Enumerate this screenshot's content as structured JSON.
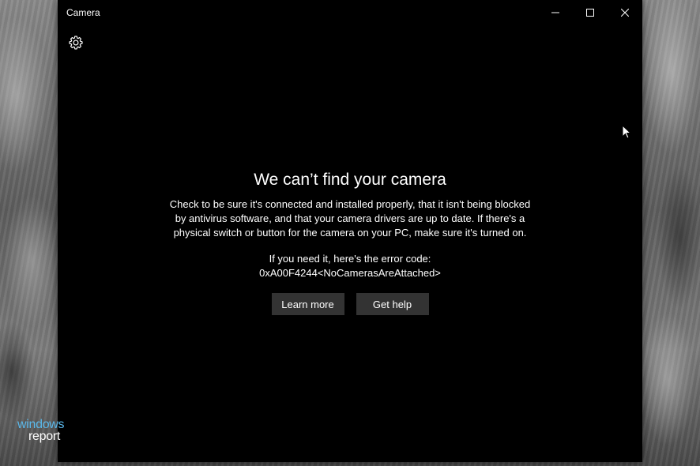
{
  "window": {
    "title": "Camera"
  },
  "controls": {
    "minimize": "minimize-icon",
    "maximize": "maximize-icon",
    "close": "close-icon",
    "settings": "gear-icon"
  },
  "error": {
    "heading": "We can’t find your camera",
    "message": "Check to be sure it's connected and installed properly, that it isn't being blocked by antivirus software, and that your camera drivers are up to date. If there's a physical switch or button for the camera on your PC, make sure it's turned on.",
    "code_label": "If you need it, here's the error code:",
    "code": "0xA00F4244<NoCamerasAreAttached>"
  },
  "buttons": {
    "learn_more": "Learn more",
    "get_help": "Get help"
  },
  "watermark": {
    "line1": "windows",
    "line2": "report"
  },
  "colors": {
    "window_bg": "#000000",
    "button_bg": "#333333",
    "text": "#ffffff",
    "watermark_accent": "#5bb8ea"
  }
}
